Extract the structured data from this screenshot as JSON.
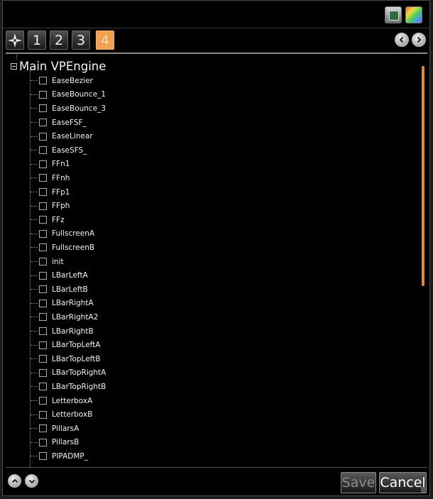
{
  "tabs": [
    {
      "label": "",
      "icon": "compass-star-icon"
    },
    {
      "label": "1"
    },
    {
      "label": "2"
    },
    {
      "label": "3"
    },
    {
      "label": "4",
      "active": true
    }
  ],
  "tree": {
    "root_label": "Main VPEngine",
    "items": [
      "EaseBezier",
      "EaseBounce_1",
      "EaseBounce_3",
      "EaseFSF_",
      "EaseLinear",
      "EaseSFS_",
      "FFn1",
      "FFnh",
      "FFp1",
      "FFph",
      "FFz",
      "FullscreenA",
      "FullscreenB",
      "init",
      "LBarLeftA",
      "LBarLeftB",
      "LBarRightA",
      "LBarRightA2",
      "LBarRightB",
      "LBarTopLeftA",
      "LBarTopLeftB",
      "LBarTopRightA",
      "LBarTopRightB",
      "LetterboxA",
      "LetterboxB",
      "PillarsA",
      "PillarsB",
      "PIPADMP_"
    ]
  },
  "footer": {
    "save_label": "Save",
    "cancel_label": "Cancel"
  },
  "colors": {
    "accent": "#f0a050",
    "scroll_thumb": "#e08a40",
    "background": "#000000"
  },
  "icons": {
    "save_settings": "save-settings-icon",
    "color_palette": "color-palette-icon",
    "previous": "chevron-left-icon",
    "next": "chevron-right-icon",
    "scroll_up": "chevron-up-icon",
    "scroll_down": "chevron-down-icon"
  }
}
